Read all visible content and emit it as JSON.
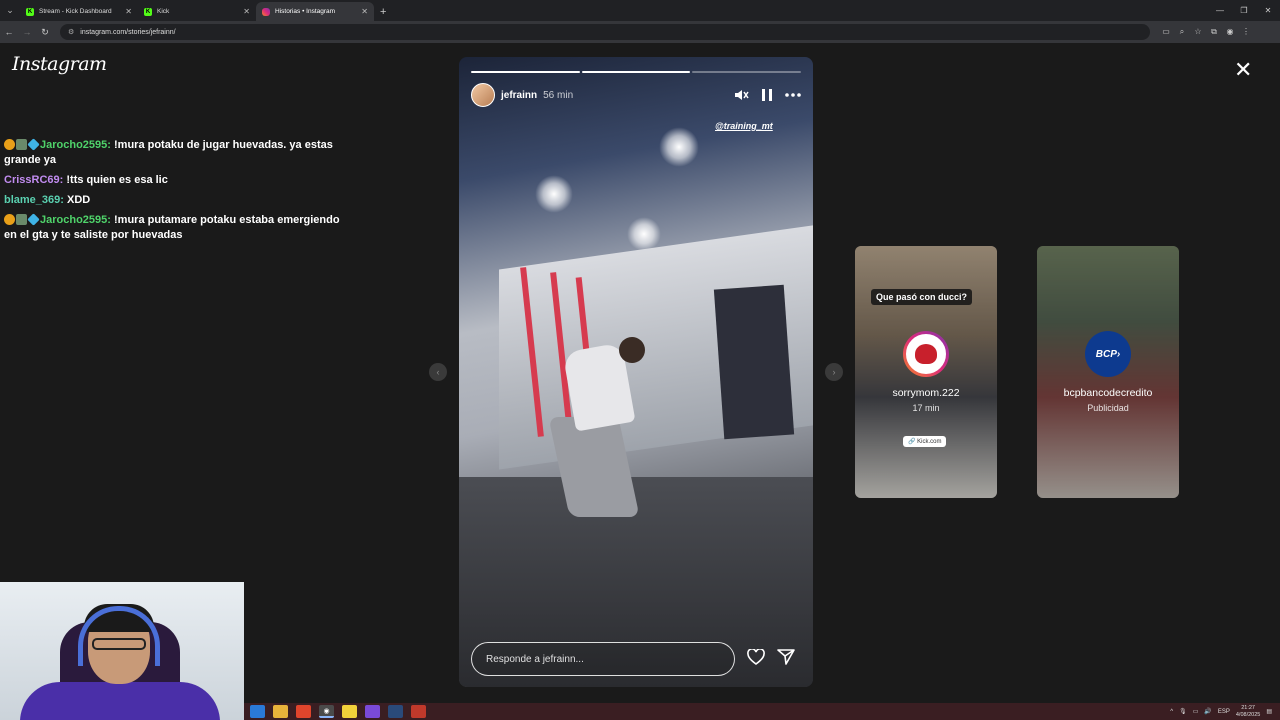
{
  "browser": {
    "tabs": [
      {
        "title": "Stream - Kick Dashboard",
        "icon": "kick-icon",
        "active": false
      },
      {
        "title": "Kick",
        "icon": "kick-icon",
        "active": false
      },
      {
        "title": "Historias • Instagram",
        "icon": "instagram-icon",
        "active": true
      }
    ],
    "new_tab": "+",
    "url": "instagram.com/stories/jefrainn/"
  },
  "page": {
    "logo": "Instagram",
    "close": "✕"
  },
  "chat": [
    {
      "user": "Jarocho2595",
      "color": "#4fd36a",
      "badges": true,
      "text": " !mura potaku de jugar huevadas. ya estas grande ya"
    },
    {
      "user": "CrissRC69",
      "color": "#c18cf0",
      "badges": false,
      "text": " !tts quien es esa lic"
    },
    {
      "user": "blame_369",
      "color": "#5ad0b0",
      "badges": false,
      "text": " XDD"
    },
    {
      "user": "Jarocho2595",
      "color": "#4fd36a",
      "badges": true,
      "text": " !mura putamare potaku estaba emergiendo en el gta y te saliste por huevadas"
    }
  ],
  "story": {
    "username": "jefrainn",
    "age": "56 min",
    "mention": "@training_mt",
    "progress": [
      1,
      1,
      0
    ],
    "reply_placeholder": "Responde a jefrainn..."
  },
  "previews": [
    {
      "question": "Que pasó con ducci?",
      "username": "sorrymom.222",
      "sub": "17 min",
      "link": "Kick.com"
    },
    {
      "question": "",
      "username": "bcpbancodecredito",
      "sub": "Publicidad",
      "avatar_text": "BCP›"
    }
  ],
  "taskbar": {
    "lang": "ESP",
    "time": "21:27",
    "date": "4/08/2025"
  },
  "colors": {
    "page_bg": "#1a1a1a",
    "chrome_bg": "#202124",
    "taskbar_bg": "#3a1e22"
  }
}
